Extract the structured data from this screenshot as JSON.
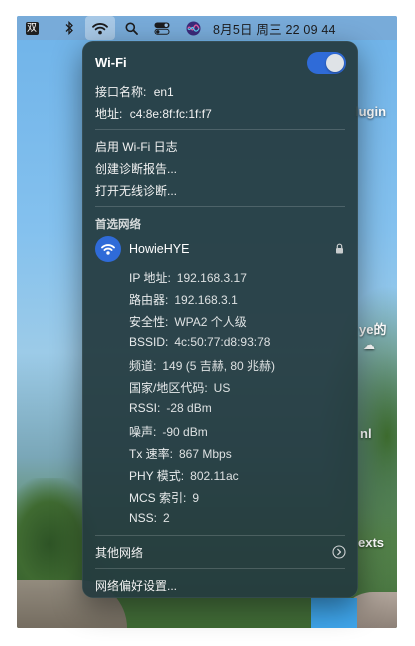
{
  "menubar": {
    "input_method": "双",
    "clock": "8月5日 周三  22 09 44"
  },
  "desktop_peek": {
    "t1": "lugin",
    "t2": "ye的",
    "t3": "nl",
    "t4": "exts"
  },
  "wifi": {
    "title": "Wi-Fi",
    "interface_label": "接口名称:",
    "interface_value": "en1",
    "address_label": "地址:",
    "address_value": "c4:8e:8f:fc:1f:f7",
    "actions": [
      "启用 Wi-Fi 日志",
      "创建诊断报告...",
      "打开无线诊断..."
    ],
    "preferred_heading": "首选网络",
    "network": {
      "name": "HowieHYE",
      "details": [
        {
          "label": "IP 地址:",
          "value": "192.168.3.17"
        },
        {
          "label": "路由器:",
          "value": "192.168.3.1"
        },
        {
          "label": "安全性:",
          "value": "WPA2 个人级"
        },
        {
          "label": "BSSID:",
          "value": "4c:50:77:d8:93:78"
        },
        {
          "label": "频道:",
          "value": "149 (5 吉赫, 80 兆赫)"
        },
        {
          "label": "国家/地区代码:",
          "value": "US"
        },
        {
          "label": "RSSI:",
          "value": "-28 dBm"
        },
        {
          "label": "噪声:",
          "value": "-90 dBm"
        },
        {
          "label": "Tx 速率:",
          "value": "867 Mbps"
        },
        {
          "label": "PHY 模式:",
          "value": "802.11ac"
        },
        {
          "label": "MCS 索引:",
          "value": "9"
        },
        {
          "label": "NSS:",
          "value": "2"
        }
      ]
    },
    "other_networks": "其他网络",
    "preferences": "网络偏好设置..."
  },
  "colors": {
    "accent": "#2f6bd8",
    "panel": "#243a3e"
  }
}
